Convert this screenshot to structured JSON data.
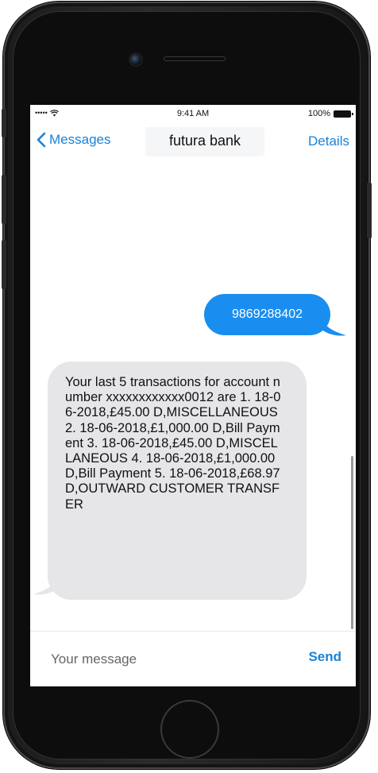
{
  "status_bar": {
    "signal": "•••••",
    "time": "9:41 AM",
    "battery": "100%"
  },
  "nav": {
    "back_label": "Messages",
    "contact_name": "futura bank",
    "details_label": "Details"
  },
  "messages": {
    "sent": "9869288402",
    "received": "Your last 5 transactions for account number xxxxxxxxxxxx0012 are 1. 18-06-2018,£45.00 D,MISCELLANEOUS 2. 18-06-2018,£1,000.00 D,Bill Payment 3. 18-06-2018,£45.00 D,MISCELLANEOUS 4. 18-06-2018,£1,000.00 D,Bill Payment 5. 18-06-2018,£68.97 D,OUTWARD CUSTOMER TRANSFER"
  },
  "compose": {
    "placeholder": "Your message",
    "send_label": "Send"
  },
  "colors": {
    "accent": "#1a82d7",
    "sent_bubble": "#1a8ef0",
    "received_bubble": "#e6e6e9",
    "phone_body": "#1c1c1c"
  },
  "icons": {
    "back": "chevron-left-icon",
    "wifi": "wifi-icon",
    "battery": "battery-icon"
  }
}
